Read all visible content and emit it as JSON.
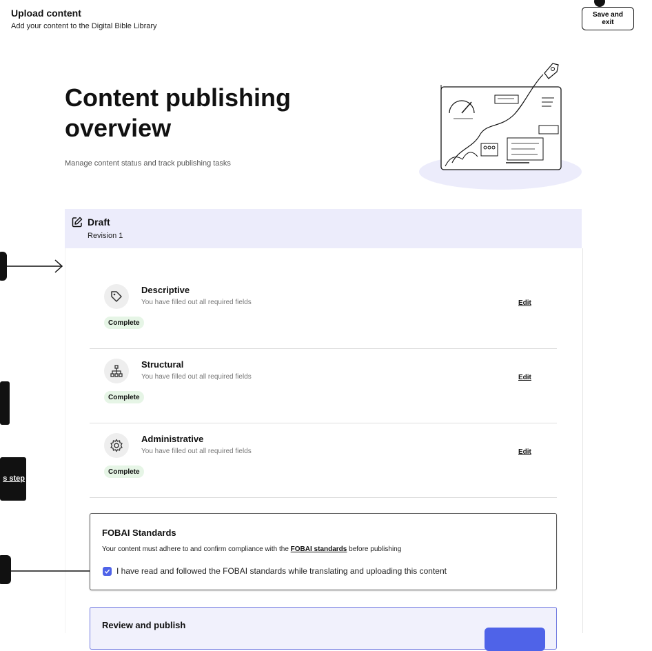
{
  "header": {
    "title": "Upload content",
    "subtitle": "Add your content to the Digital Bible Library",
    "save_exit_label": "Save and exit"
  },
  "hero": {
    "title": "Content publishing overview",
    "subtitle": "Manage content status and track publishing tasks"
  },
  "draft": {
    "status": "Draft",
    "revision": "Revision 1",
    "icon": "edit-icon"
  },
  "tasks": [
    {
      "title": "Descriptive",
      "description": "You have filled out all required fields",
      "status": "Complete",
      "edit_label": "Edit",
      "icon": "tag-icon"
    },
    {
      "title": "Structural",
      "description": "You have filled out all required fields",
      "status": "Complete",
      "edit_label": "Edit",
      "icon": "hierarchy-icon"
    },
    {
      "title": "Administrative",
      "description": "You have filled out all required fields",
      "status": "Complete",
      "edit_label": "Edit",
      "icon": "gear-icon"
    }
  ],
  "fobai": {
    "title": "FOBAI Standards",
    "desc_before": "Your content must adhere to and confirm compliance with the ",
    "link": "FOBAI standards",
    "desc_after": " before publishing",
    "checkbox_label": "I have read and followed the FOBAI standards while translating and uploading this content",
    "checked": true
  },
  "review": {
    "title": "Review and publish"
  },
  "tour": {
    "step_fragment": "s step"
  },
  "colors": {
    "accent": "#4f63e8",
    "draft_bg": "#ececfb",
    "complete_badge": "#e6f5e6"
  }
}
